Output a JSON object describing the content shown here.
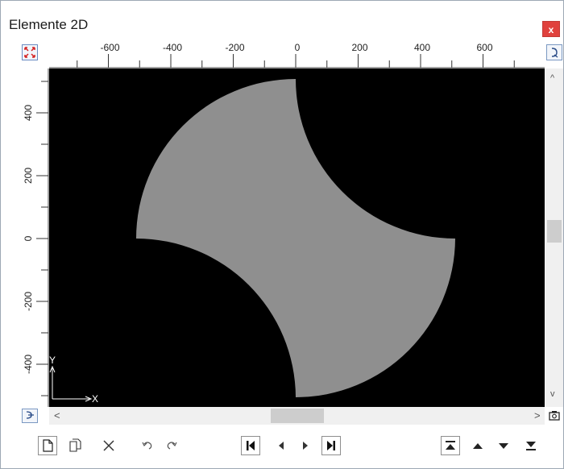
{
  "window": {
    "title": "Elemente 2D",
    "close_label": "x"
  },
  "icons": {
    "fit": "fit-view-icon",
    "zoom_reset": "zoom-icon",
    "zoom_plus": "zoom-plus-icon",
    "camera": "camera-icon",
    "new_page": "new-page-icon",
    "copy_page": "copy-page-icon",
    "delete": "delete-icon",
    "undo": "undo-icon",
    "redo": "redo-icon",
    "first": "first-icon",
    "prev": "previous-icon",
    "next": "next-icon",
    "last": "last-icon",
    "top": "move-top-icon",
    "up": "move-up-icon",
    "down": "move-down-icon",
    "bottom": "move-bottom-icon"
  },
  "ruler": {
    "x_labels": [
      "-600",
      "-400",
      "-200",
      "0",
      "200",
      "400",
      "600"
    ],
    "y_labels": [
      "400",
      "200",
      "0",
      "-200",
      "-400"
    ]
  },
  "axes": {
    "x_label": "X",
    "y_label": "Y"
  },
  "scroll": {
    "left": "<",
    "right": ">",
    "up": "^",
    "down": "v"
  },
  "colors": {
    "canvas_bg": "#000000",
    "shape_fill": "#8f8f8f",
    "close_bg": "#e0413d",
    "accent": "#2a4c88"
  }
}
